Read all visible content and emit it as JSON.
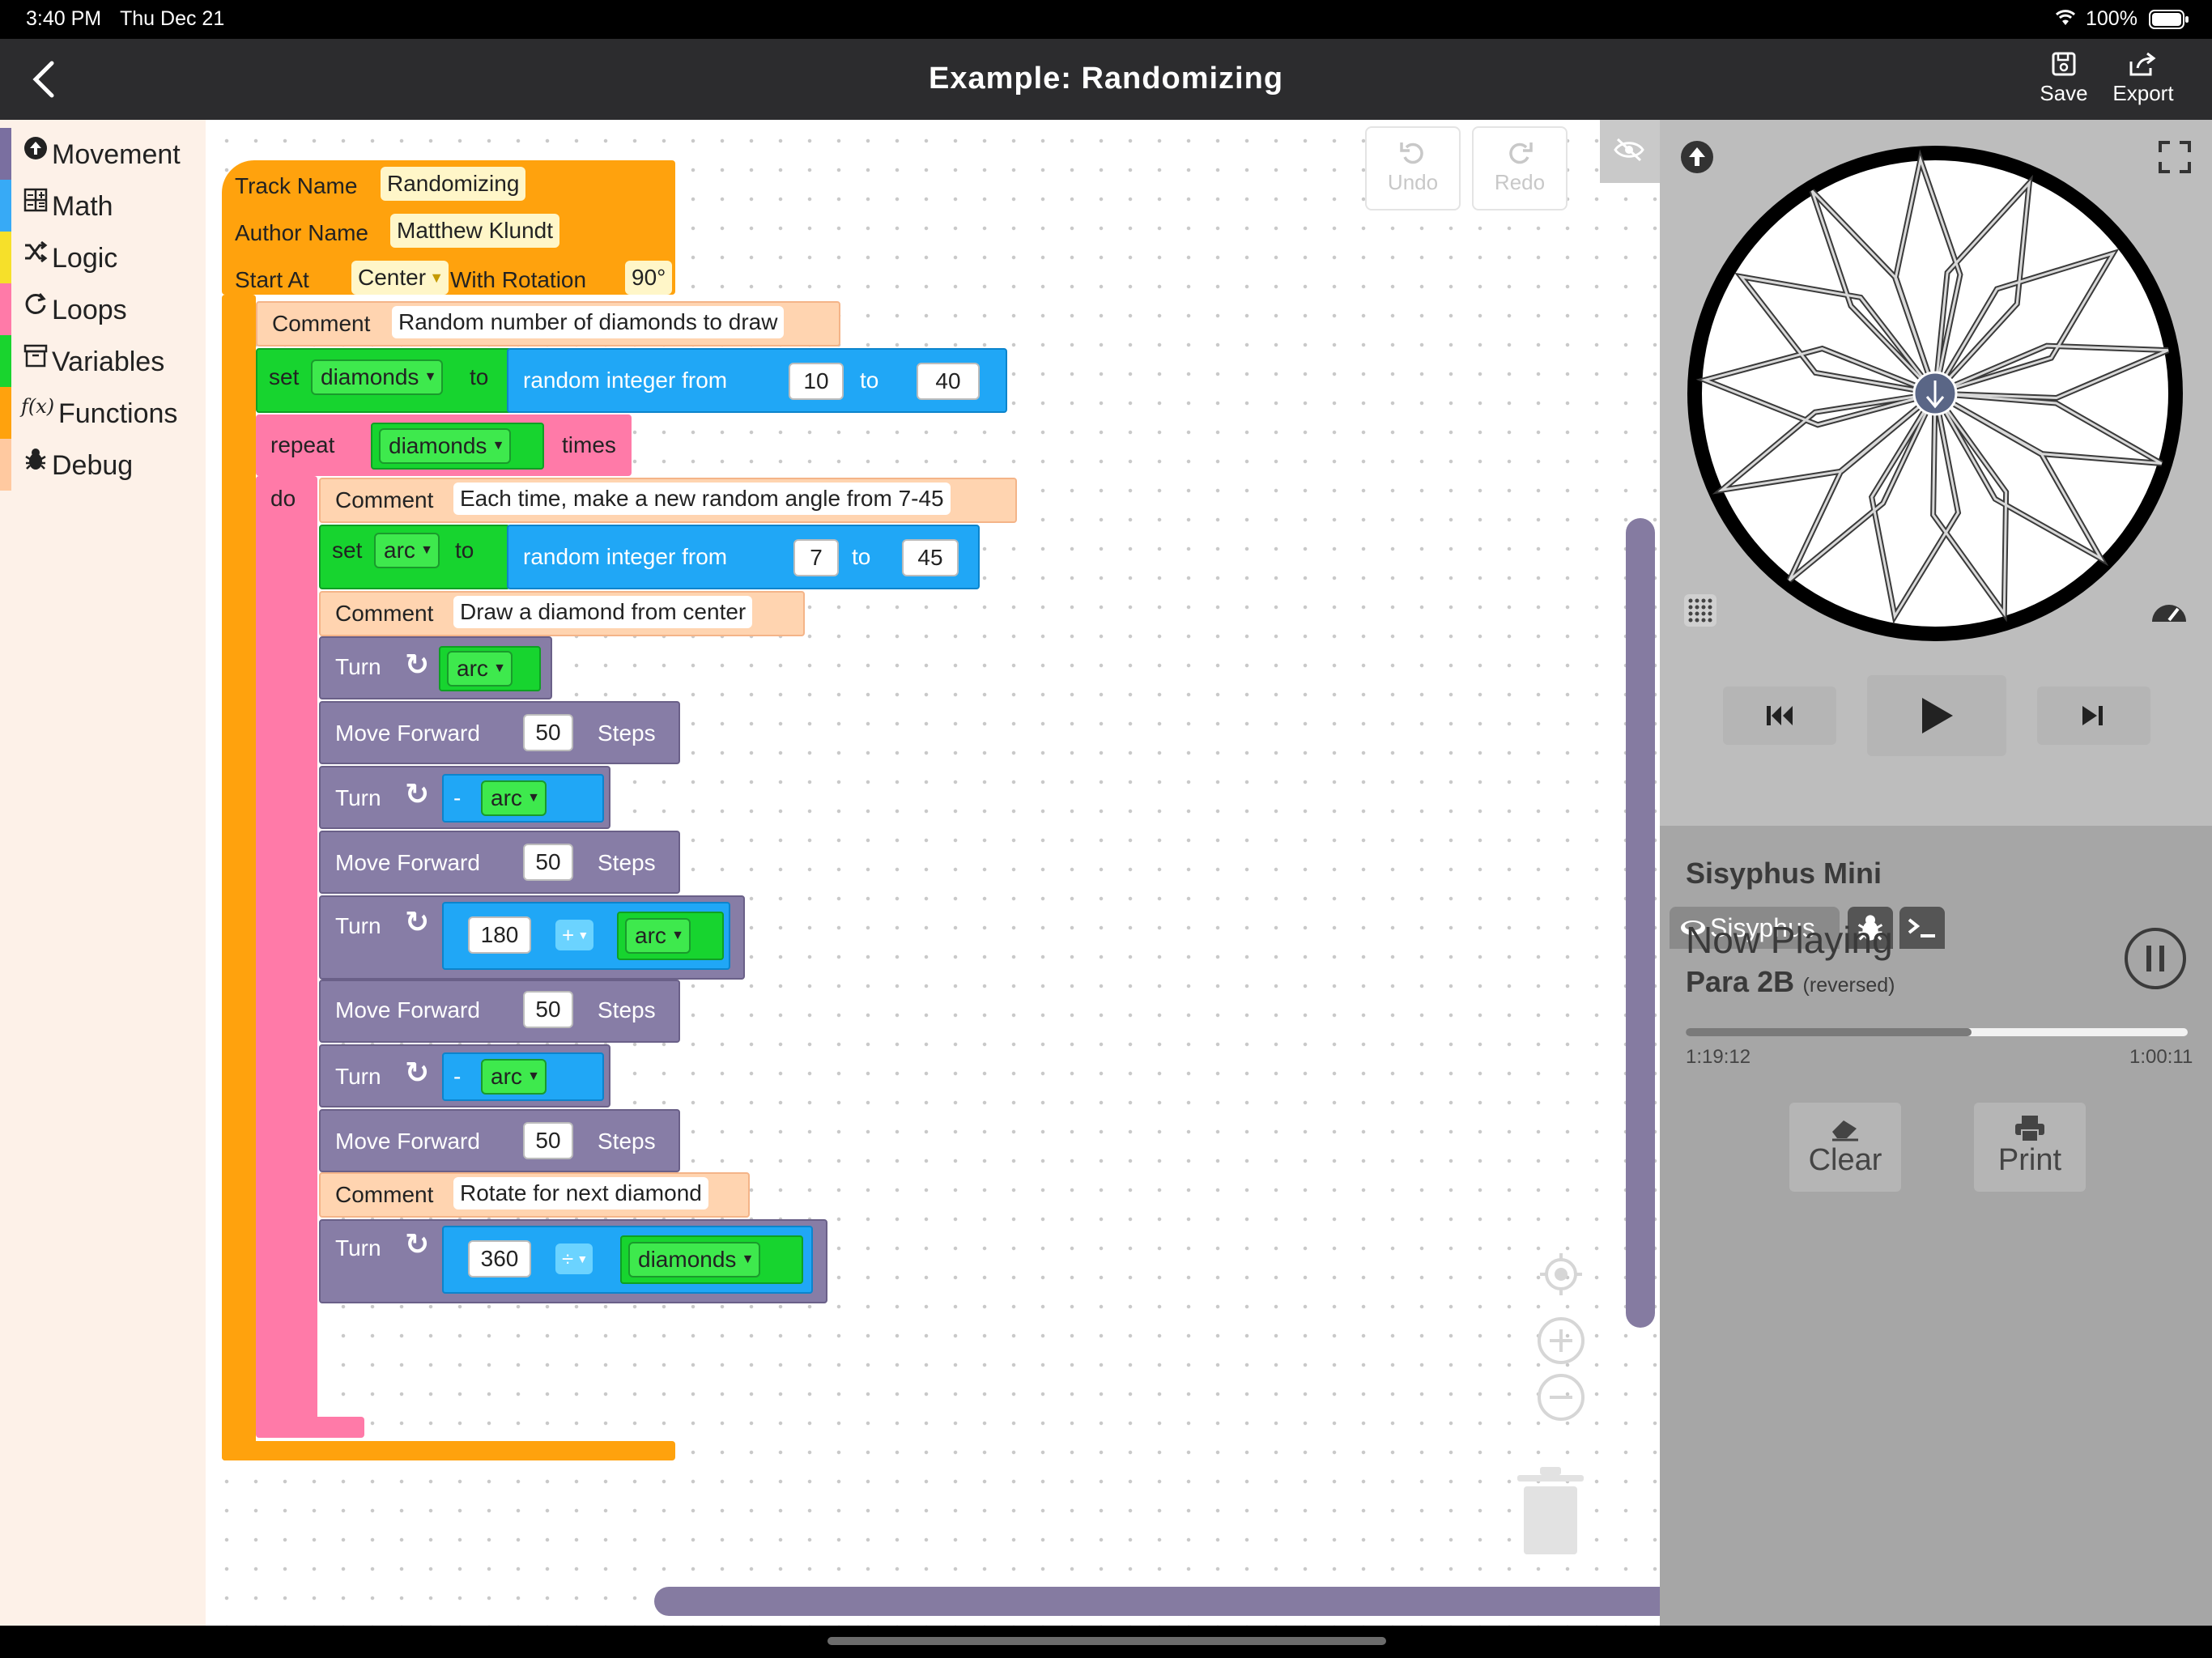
{
  "status_bar": {
    "time": "3:40 PM",
    "date": "Thu Dec 21",
    "battery": "100%"
  },
  "header": {
    "title": "Example: Randomizing",
    "save_label": "Save",
    "export_label": "Export"
  },
  "sidebar": {
    "items": [
      {
        "label": "Movement",
        "icon": "arrow-up-circle-icon",
        "color": "#7a6fa0"
      },
      {
        "label": "Math",
        "icon": "calculator-icon",
        "color": "#37aaf6"
      },
      {
        "label": "Logic",
        "icon": "shuffle-icon",
        "color": "#f6e02a"
      },
      {
        "label": "Loops",
        "icon": "loop-icon",
        "color": "#ff7aa8"
      },
      {
        "label": "Variables",
        "icon": "box-icon",
        "color": "#19d42e"
      },
      {
        "label": "Functions",
        "icon": "function-icon",
        "color": "#ffa20d"
      },
      {
        "label": "Debug",
        "icon": "bug-icon",
        "color": "#ffc9a0"
      }
    ]
  },
  "toolbar": {
    "undo_label": "Undo",
    "redo_label": "Redo"
  },
  "blocks": {
    "track_name_label": "Track Name",
    "track_name_value": "Randomizing",
    "author_name_label": "Author Name",
    "author_name_value": "Matthew Klundt",
    "start_at_label": "Start At",
    "start_at_value": "Center",
    "with_rotation_label": "With Rotation",
    "with_rotation_value": "90°",
    "comment_label": "Comment",
    "comment1": "Random number of diamonds to draw",
    "set_label": "set",
    "to_label": "to",
    "var_diamonds": "diamonds",
    "var_arc": "arc",
    "random_label": "random integer from",
    "rand1_from": "10",
    "rand1_to": "40",
    "repeat_label": "repeat",
    "times_label": "times",
    "do_label": "do",
    "comment2": "Each time, make a new random angle from 7-45",
    "rand2_from": "7",
    "rand2_to": "45",
    "comment3": "Draw a diamond from center",
    "turn_label": "Turn",
    "move_forward_label": "Move Forward",
    "steps_label": "Steps",
    "steps_value": "50",
    "minus": "-",
    "plus_op": "+",
    "div_op": "÷",
    "num_180": "180",
    "num_360": "360",
    "comment4": "Rotate for next diamond"
  },
  "right_panel": {
    "tab_sisyphus": "Sisyphus",
    "device_name": "Sisyphus Mini",
    "now_playing_label": "Now Playing",
    "track_name": "Para 2B",
    "track_note": "(reversed)",
    "elapsed": "1:19:12",
    "remaining": "1:00:11",
    "progress": 0.57,
    "clear_label": "Clear",
    "print_label": "Print"
  }
}
